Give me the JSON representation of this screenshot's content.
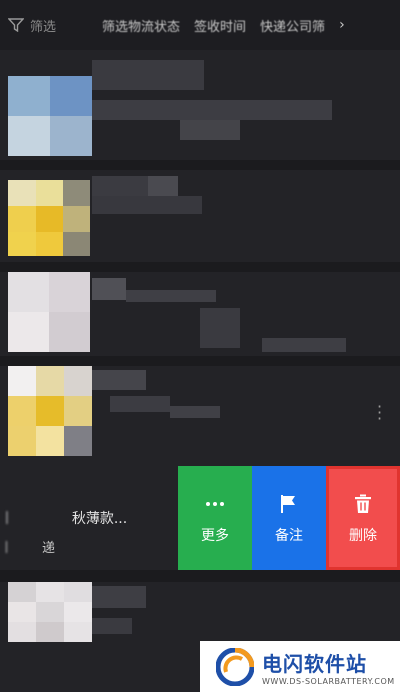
{
  "filter_bar": {
    "filter_label": "筛选",
    "options": [
      "筛选物流状态",
      "签收时间",
      "快递公司筛"
    ],
    "chevron": "›"
  },
  "swiped_item": {
    "title": "秋薄款...",
    "subtitle": "递"
  },
  "actions": {
    "more": {
      "label": "更多",
      "icon": "ellipsis-icon",
      "color": "#27ae4f"
    },
    "remark": {
      "label": "备注",
      "icon": "flag-icon",
      "color": "#1a72e8"
    },
    "delete": {
      "label": "删除",
      "icon": "trash-icon",
      "color": "#f24d4d"
    }
  },
  "row_menu_icon": "vertical-dots-icon",
  "watermark": {
    "title": "电闪软件站",
    "subtitle": "WWW.DS-SOLARBATTERY.COM"
  }
}
